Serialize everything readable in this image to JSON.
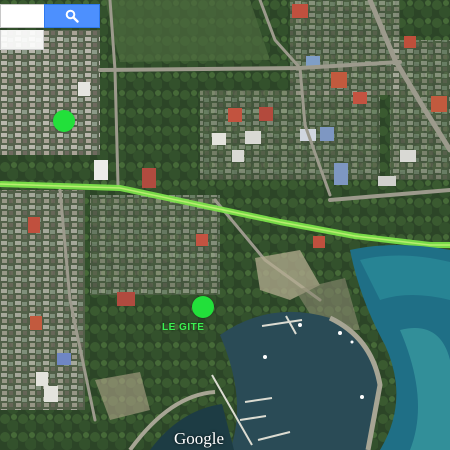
{
  "search": {
    "placeholder": "",
    "button_icon": "search-icon"
  },
  "markers": [
    {
      "id": "marker-a",
      "label": "",
      "color": "#22e03a"
    },
    {
      "id": "marker-le-gite",
      "label": "LE GITE",
      "color": "#22e03a"
    }
  ],
  "attribution": {
    "logo_text": "Google"
  },
  "colors": {
    "road_highlight": "#7ee84a",
    "sea": "#1f6f86",
    "lagoon": "#2a4b56",
    "vegetation": "#2e4a2a"
  }
}
